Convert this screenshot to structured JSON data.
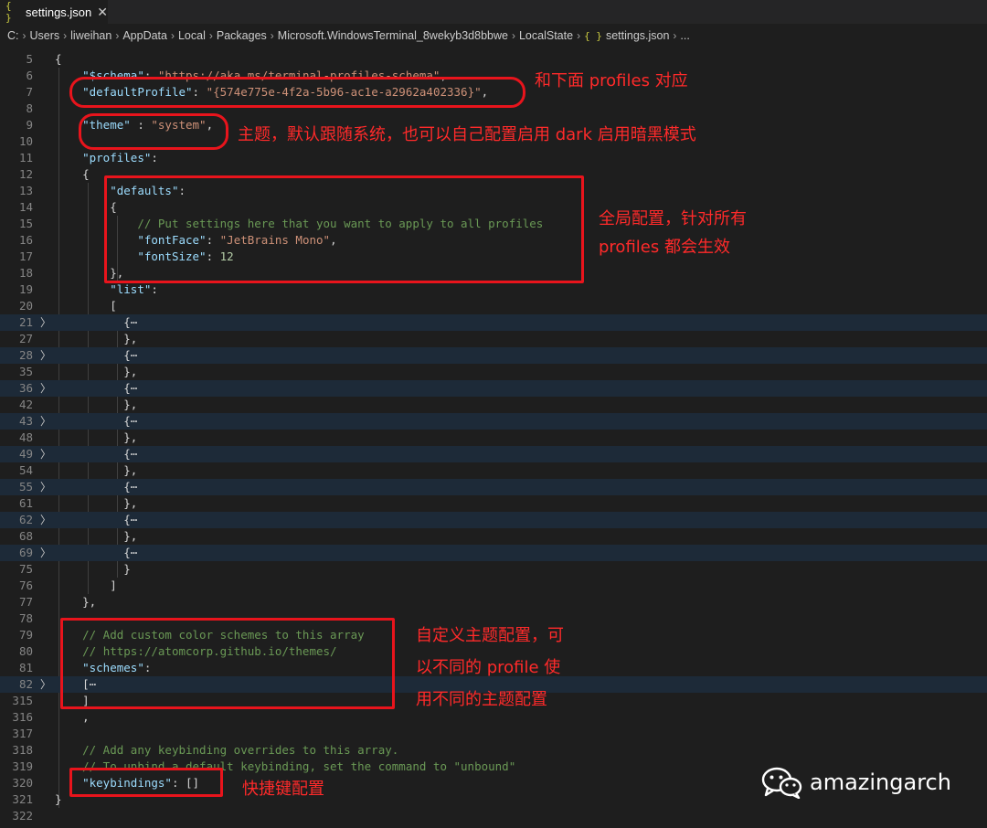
{
  "tab": {
    "icon": "{ }",
    "title": "settings.json",
    "close": "✕"
  },
  "breadcrumb": [
    "C:",
    "Users",
    "liweihan",
    "AppData",
    "Local",
    "Packages",
    "Microsoft.WindowsTerminal_8wekyb3d8bbwe",
    "LocalState",
    "settings.json",
    "..."
  ],
  "breadcrumb_file_icon": "{ }",
  "lines": [
    {
      "n": "5",
      "fold": false,
      "bg": false,
      "t": [
        [
          "p",
          "{"
        ]
      ]
    },
    {
      "n": "6",
      "fold": false,
      "bg": false,
      "t": [
        [
          "p",
          "    "
        ],
        [
          "k",
          "\"$schema\""
        ],
        [
          "p",
          ": "
        ],
        [
          "s",
          "\"https://aka.ms/terminal-profiles-schema\""
        ],
        [
          "p",
          ","
        ]
      ]
    },
    {
      "n": "7",
      "fold": false,
      "bg": false,
      "t": [
        [
          "p",
          "    "
        ],
        [
          "k",
          "\"defaultProfile\""
        ],
        [
          "p",
          ": "
        ],
        [
          "s",
          "\"{574e775e-4f2a-5b96-ac1e-a2962a402336}\""
        ],
        [
          "p",
          ","
        ]
      ]
    },
    {
      "n": "8",
      "fold": false,
      "bg": false,
      "t": []
    },
    {
      "n": "9",
      "fold": false,
      "bg": false,
      "t": [
        [
          "p",
          "    "
        ],
        [
          "k",
          "\"theme\""
        ],
        [
          "p",
          " : "
        ],
        [
          "s",
          "\"system\""
        ],
        [
          "p",
          ","
        ]
      ]
    },
    {
      "n": "10",
      "fold": false,
      "bg": false,
      "t": []
    },
    {
      "n": "11",
      "fold": false,
      "bg": false,
      "t": [
        [
          "p",
          "    "
        ],
        [
          "k",
          "\"profiles\""
        ],
        [
          "p",
          ":"
        ]
      ]
    },
    {
      "n": "12",
      "fold": false,
      "bg": false,
      "t": [
        [
          "p",
          "    {"
        ]
      ]
    },
    {
      "n": "13",
      "fold": false,
      "bg": false,
      "t": [
        [
          "p",
          "        "
        ],
        [
          "k",
          "\"defaults\""
        ],
        [
          "p",
          ":"
        ]
      ]
    },
    {
      "n": "14",
      "fold": false,
      "bg": false,
      "t": [
        [
          "p",
          "        {"
        ]
      ]
    },
    {
      "n": "15",
      "fold": false,
      "bg": false,
      "t": [
        [
          "p",
          "            "
        ],
        [
          "c",
          "// Put settings here that you want to apply to all profiles"
        ]
      ]
    },
    {
      "n": "16",
      "fold": false,
      "bg": false,
      "t": [
        [
          "p",
          "            "
        ],
        [
          "k",
          "\"fontFace\""
        ],
        [
          "p",
          ": "
        ],
        [
          "s",
          "\"JetBrains Mono\""
        ],
        [
          "p",
          ","
        ]
      ]
    },
    {
      "n": "17",
      "fold": false,
      "bg": false,
      "t": [
        [
          "p",
          "            "
        ],
        [
          "k",
          "\"fontSize\""
        ],
        [
          "p",
          ": "
        ],
        [
          "n",
          "12"
        ]
      ]
    },
    {
      "n": "18",
      "fold": false,
      "bg": false,
      "t": [
        [
          "p",
          "        },"
        ]
      ]
    },
    {
      "n": "19",
      "fold": false,
      "bg": false,
      "t": [
        [
          "p",
          "        "
        ],
        [
          "k",
          "\"list\""
        ],
        [
          "p",
          ":"
        ]
      ]
    },
    {
      "n": "20",
      "fold": false,
      "bg": false,
      "t": [
        [
          "p",
          "        ["
        ]
      ]
    },
    {
      "n": "21",
      "fold": true,
      "bg": true,
      "t": [
        [
          "p",
          "          {⋯"
        ]
      ]
    },
    {
      "n": "27",
      "fold": false,
      "bg": false,
      "t": [
        [
          "p",
          "          },"
        ]
      ]
    },
    {
      "n": "28",
      "fold": true,
      "bg": true,
      "t": [
        [
          "p",
          "          {⋯"
        ]
      ]
    },
    {
      "n": "35",
      "fold": false,
      "bg": false,
      "t": [
        [
          "p",
          "          },"
        ]
      ]
    },
    {
      "n": "36",
      "fold": true,
      "bg": true,
      "t": [
        [
          "p",
          "          {⋯"
        ]
      ]
    },
    {
      "n": "42",
      "fold": false,
      "bg": false,
      "t": [
        [
          "p",
          "          },"
        ]
      ]
    },
    {
      "n": "43",
      "fold": true,
      "bg": true,
      "t": [
        [
          "p",
          "          {⋯"
        ]
      ]
    },
    {
      "n": "48",
      "fold": false,
      "bg": false,
      "t": [
        [
          "p",
          "          },"
        ]
      ]
    },
    {
      "n": "49",
      "fold": true,
      "bg": true,
      "t": [
        [
          "p",
          "          {⋯"
        ]
      ]
    },
    {
      "n": "54",
      "fold": false,
      "bg": false,
      "t": [
        [
          "p",
          "          },"
        ]
      ]
    },
    {
      "n": "55",
      "fold": true,
      "bg": true,
      "t": [
        [
          "p",
          "          {⋯"
        ]
      ]
    },
    {
      "n": "61",
      "fold": false,
      "bg": false,
      "t": [
        [
          "p",
          "          },"
        ]
      ]
    },
    {
      "n": "62",
      "fold": true,
      "bg": true,
      "t": [
        [
          "p",
          "          {⋯"
        ]
      ]
    },
    {
      "n": "68",
      "fold": false,
      "bg": false,
      "t": [
        [
          "p",
          "          },"
        ]
      ]
    },
    {
      "n": "69",
      "fold": true,
      "bg": true,
      "t": [
        [
          "p",
          "          {⋯"
        ]
      ]
    },
    {
      "n": "75",
      "fold": false,
      "bg": false,
      "t": [
        [
          "p",
          "          }"
        ]
      ]
    },
    {
      "n": "76",
      "fold": false,
      "bg": false,
      "t": [
        [
          "p",
          "        ]"
        ]
      ]
    },
    {
      "n": "77",
      "fold": false,
      "bg": false,
      "t": [
        [
          "p",
          "    },"
        ]
      ]
    },
    {
      "n": "78",
      "fold": false,
      "bg": false,
      "t": []
    },
    {
      "n": "79",
      "fold": false,
      "bg": false,
      "t": [
        [
          "p",
          "    "
        ],
        [
          "c",
          "// Add custom color schemes to this array"
        ]
      ]
    },
    {
      "n": "80",
      "fold": false,
      "bg": false,
      "t": [
        [
          "p",
          "    "
        ],
        [
          "c",
          "// "
        ],
        [
          "c",
          "https://atomcorp.github.io/themes/"
        ]
      ]
    },
    {
      "n": "81",
      "fold": false,
      "bg": false,
      "t": [
        [
          "p",
          "    "
        ],
        [
          "k",
          "\"schemes\""
        ],
        [
          "p",
          ":"
        ]
      ]
    },
    {
      "n": "82",
      "fold": true,
      "bg": true,
      "t": [
        [
          "p",
          "    [⋯"
        ]
      ]
    },
    {
      "n": "315",
      "fold": false,
      "bg": false,
      "t": [
        [
          "p",
          "    ]"
        ]
      ]
    },
    {
      "n": "316",
      "fold": false,
      "bg": false,
      "t": [
        [
          "p",
          "    ,"
        ]
      ]
    },
    {
      "n": "317",
      "fold": false,
      "bg": false,
      "t": []
    },
    {
      "n": "318",
      "fold": false,
      "bg": false,
      "t": [
        [
          "p",
          "    "
        ],
        [
          "c",
          "// Add any keybinding overrides to this array."
        ]
      ]
    },
    {
      "n": "319",
      "fold": false,
      "bg": false,
      "t": [
        [
          "p",
          "    "
        ],
        [
          "c",
          "// To unbind a default keybinding, set the command to \"unbound\""
        ]
      ]
    },
    {
      "n": "320",
      "fold": false,
      "bg": false,
      "t": [
        [
          "p",
          "    "
        ],
        [
          "k",
          "\"keybindings\""
        ],
        [
          "p",
          ": []"
        ]
      ]
    },
    {
      "n": "321",
      "fold": false,
      "bg": false,
      "t": [
        [
          "p",
          "}"
        ]
      ]
    },
    {
      "n": "322",
      "fold": false,
      "bg": false,
      "t": []
    }
  ],
  "annotations": {
    "profiles_default": "和下面 profiles 对应",
    "theme": "主题，默认跟随系统，也可以自己配置启用 dark 启用暗黑模式",
    "defaults": "全局配置，针对所有\nprofiles 都会生效",
    "schemes": "自定义主题配置，可\n以不同的 profile 使\n用不同的主题配置",
    "keybindings": "快捷键配置"
  },
  "watermark": {
    "text": "amazingarch",
    "icon": "wechat-icon"
  },
  "colors": {
    "annotation_red": "#e8141c",
    "editor_bg": "#1e1e1e",
    "folded_bg": "#1d2a38"
  }
}
